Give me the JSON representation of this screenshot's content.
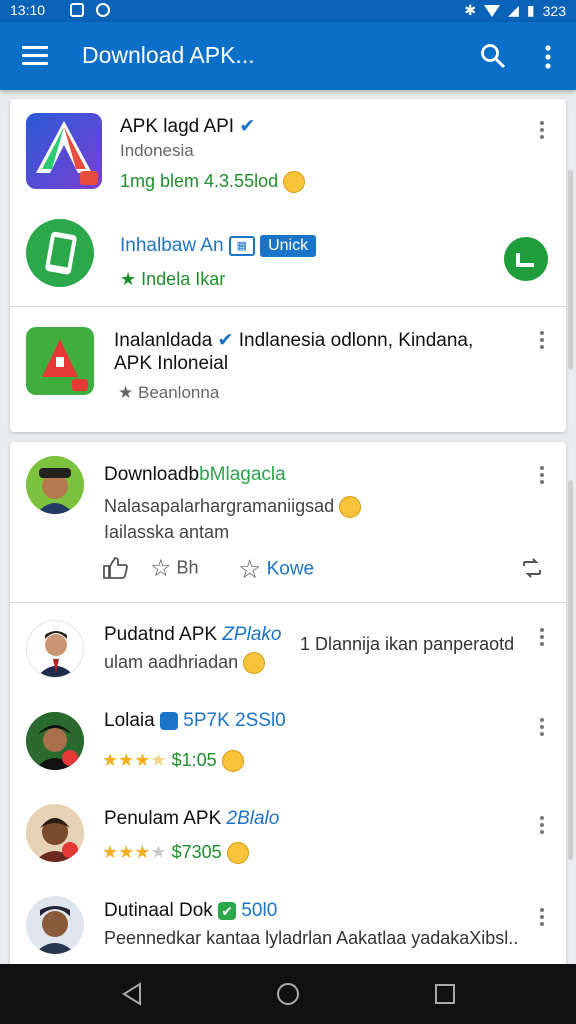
{
  "status_bar": {
    "time": "13:10",
    "battery_text": "323"
  },
  "app_bar": {
    "title": "Download APK...",
    "menu_icon": "menu-icon",
    "search_icon": "search-icon",
    "more_icon": "more-vert-icon"
  },
  "colors": {
    "app_bar": "#0b6fc7",
    "accent_green": "#1f8f2c",
    "link_blue": "#1c74c8",
    "star": "#f2b01e"
  },
  "card1": {
    "items": [
      {
        "title": "APK lagd API",
        "subtitle": "Indonesia",
        "meta": "1mg blem  4.3.55lod"
      },
      {
        "title": "Inhalbaw An",
        "chip_label": "Unick",
        "meta": "Indela Ikar"
      },
      {
        "title_line1": "Inalanldada",
        "title_line1_rest": "Indlanesia odlonn, Kindana,",
        "title_line2": "APK Inloneial",
        "meta": "Beanlonna"
      }
    ]
  },
  "card2": {
    "post": {
      "title": "Downloadb",
      "title_tag": "bMlagacla",
      "body_line1": "Nalasapalarhargramaniigsad",
      "body_line2": "Iailasska antam",
      "like_label": "",
      "star_label": "Bh",
      "save_label": "Kowe"
    },
    "list": [
      {
        "name": "Pudatnd APK",
        "tag": "ZPlako",
        "extra": "1 Dlannija ikan panperaotd",
        "sub": "ulam aadhriadan"
      },
      {
        "name": "Lolaia",
        "tag": "5P7K 2SSl0",
        "rating": 3.5,
        "price": "$1:05"
      },
      {
        "name": "Penulam APK",
        "tag": "2Blalo",
        "rating": 3.0,
        "price": "$7305"
      },
      {
        "name": "Dutinaal Dok",
        "tag": "50l0",
        "sub": "Peennedkar kantaa lyladrlan Aakatlaa yadakaXibsl.."
      }
    ]
  }
}
